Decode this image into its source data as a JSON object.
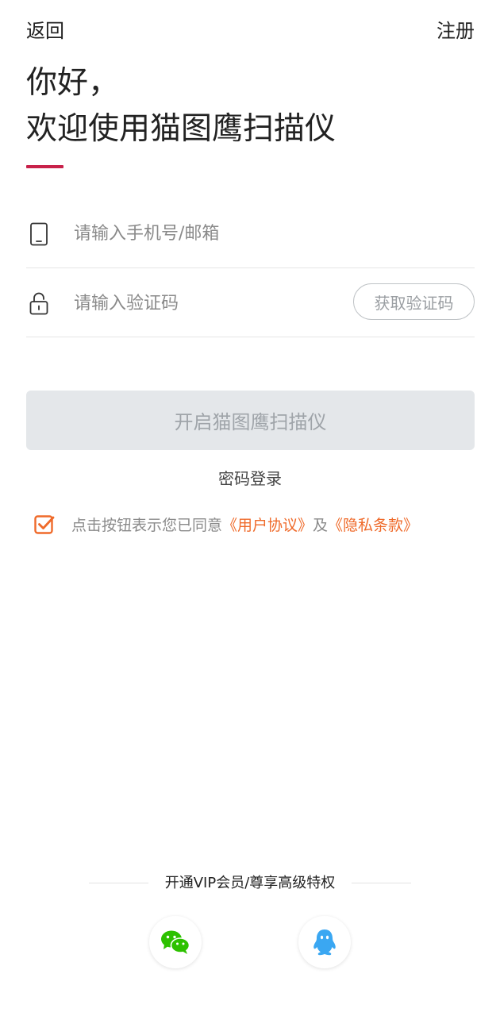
{
  "topbar": {
    "back_label": "返回",
    "register_label": "注册"
  },
  "greeting": {
    "line1": "你好，",
    "line2": "欢迎使用猫图鹰扫描仪"
  },
  "form": {
    "phone_placeholder": "请输入手机号/邮箱",
    "code_placeholder": "请输入验证码",
    "get_code_label": "获取验证码"
  },
  "main_button_label": "开启猫图鹰扫描仪",
  "password_login_label": "密码登录",
  "agreement": {
    "checked": true,
    "prefix": "点击按钮表示您已同意",
    "user_agreement": "《用户协议》",
    "conjunction": "及",
    "privacy_policy": "《隐私条款》"
  },
  "vip_text": "开通VIP会员/尊享高级特权",
  "social": {
    "wechat_icon": "wechat-icon",
    "qq_icon": "qq-icon"
  },
  "colors": {
    "accent_bar": "#c8214a",
    "link": "#ef6a2a",
    "wechat": "#2dc100",
    "qq": "#3aa7f2",
    "disabled_button": "#e4e7ea"
  }
}
